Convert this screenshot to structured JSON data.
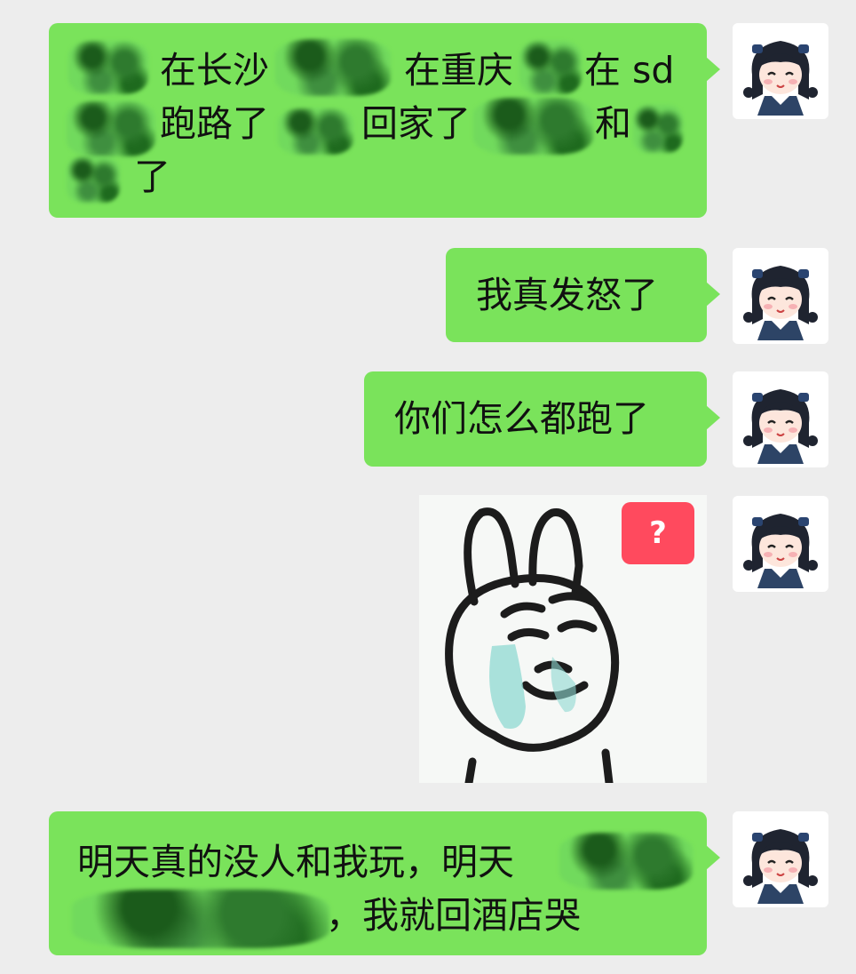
{
  "messages": [
    {
      "type": "text",
      "lines": [
        [
          "在长沙",
          "在重庆",
          "在 sd"
        ],
        [
          "跑路了",
          "回家了",
          "和"
        ],
        [
          "了"
        ]
      ]
    },
    {
      "type": "text",
      "text": "我真发怒了"
    },
    {
      "type": "text",
      "text": "你们怎么都跑了"
    },
    {
      "type": "sticker",
      "badge": "?",
      "description_icon": "crying-rabbit-sticker"
    },
    {
      "type": "text",
      "line1": "明天真的没人和我玩，明天",
      "line2": "，我就回酒店哭"
    }
  ],
  "colors": {
    "background": "#ededed",
    "bubble": "#7ae35b",
    "badge": "#ff4a5e"
  },
  "icons": {
    "avatar": "anime-girl-avatar"
  }
}
